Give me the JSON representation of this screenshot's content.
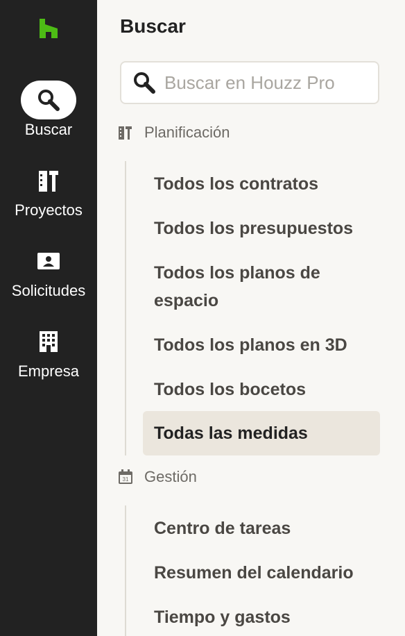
{
  "rail": {
    "logo": "houzz-logo",
    "brand_color": "#4dbc15",
    "items": [
      {
        "label": "Buscar",
        "icon": "search-icon",
        "active": true
      },
      {
        "label": "Proyectos",
        "icon": "projects-icon",
        "active": false
      },
      {
        "label": "Solicitudes",
        "icon": "contact-card-icon",
        "active": false
      },
      {
        "label": "Empresa",
        "icon": "building-icon",
        "active": false
      }
    ]
  },
  "panel": {
    "title": "Buscar",
    "search": {
      "placeholder": "Buscar en Houzz Pro",
      "value": ""
    },
    "sections": [
      {
        "label": "Planificación",
        "icon": "planning-icon",
        "items": [
          "Todos los contratos",
          "Todos los presupuestos",
          "Todos los planos de espacio",
          "Todos los planos en 3D",
          "Todos los bocetos",
          "Todas las medidas"
        ],
        "active_item": "Todas las medidas"
      },
      {
        "label": "Gestión",
        "icon": "calendar-icon",
        "items": [
          "Centro de tareas",
          "Resumen del calendario",
          "Tiempo y gastos"
        ]
      }
    ]
  },
  "colors": {
    "rail_bg": "#222222",
    "panel_bg": "#f8f7f4",
    "active_item_bg": "#ebe6dd"
  }
}
